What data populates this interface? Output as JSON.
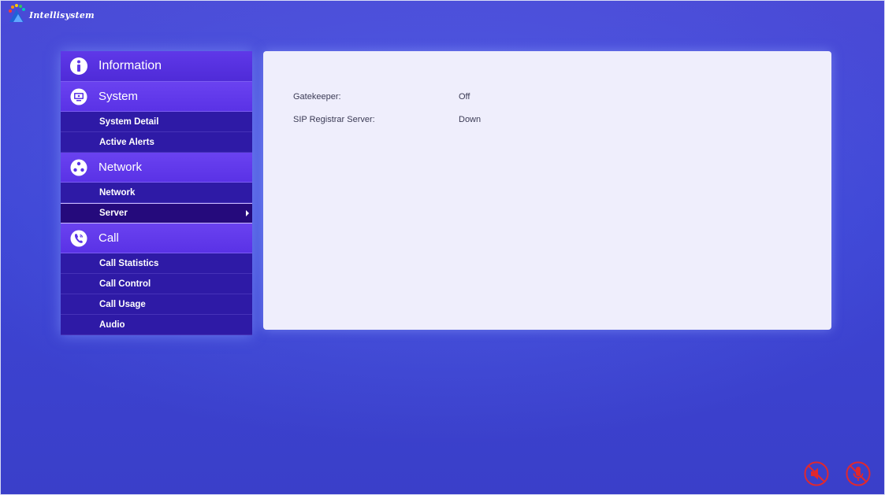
{
  "brand": {
    "logo_text": "Intellisystem"
  },
  "sidebar": {
    "information_label": "Information",
    "sections": [
      {
        "label": "System",
        "icon": "monitor-icon",
        "items": [
          {
            "label": "System Detail"
          },
          {
            "label": "Active Alerts"
          }
        ]
      },
      {
        "label": "Network",
        "icon": "network-icon",
        "items": [
          {
            "label": "Network"
          },
          {
            "label": "Server",
            "selected": true
          }
        ]
      },
      {
        "label": "Call",
        "icon": "phone-icon",
        "items": [
          {
            "label": "Call Statistics"
          },
          {
            "label": "Call Control"
          },
          {
            "label": "Call Usage"
          },
          {
            "label": "Audio"
          }
        ]
      }
    ]
  },
  "content": {
    "rows": [
      {
        "key": "Gatekeeper:",
        "value": "Off"
      },
      {
        "key": "SIP Registrar Server:",
        "value": "Down"
      }
    ]
  },
  "status": {
    "speaker": "speaker-muted-icon",
    "microphone": "microphone-muted-icon"
  },
  "colors": {
    "background": "#3d44d4",
    "section_header": "#6a42f0",
    "sub_item": "#2e1aa6",
    "sub_item_selected": "#250a7c",
    "panel": "#efeefc",
    "mute_red": "#e0282e"
  }
}
